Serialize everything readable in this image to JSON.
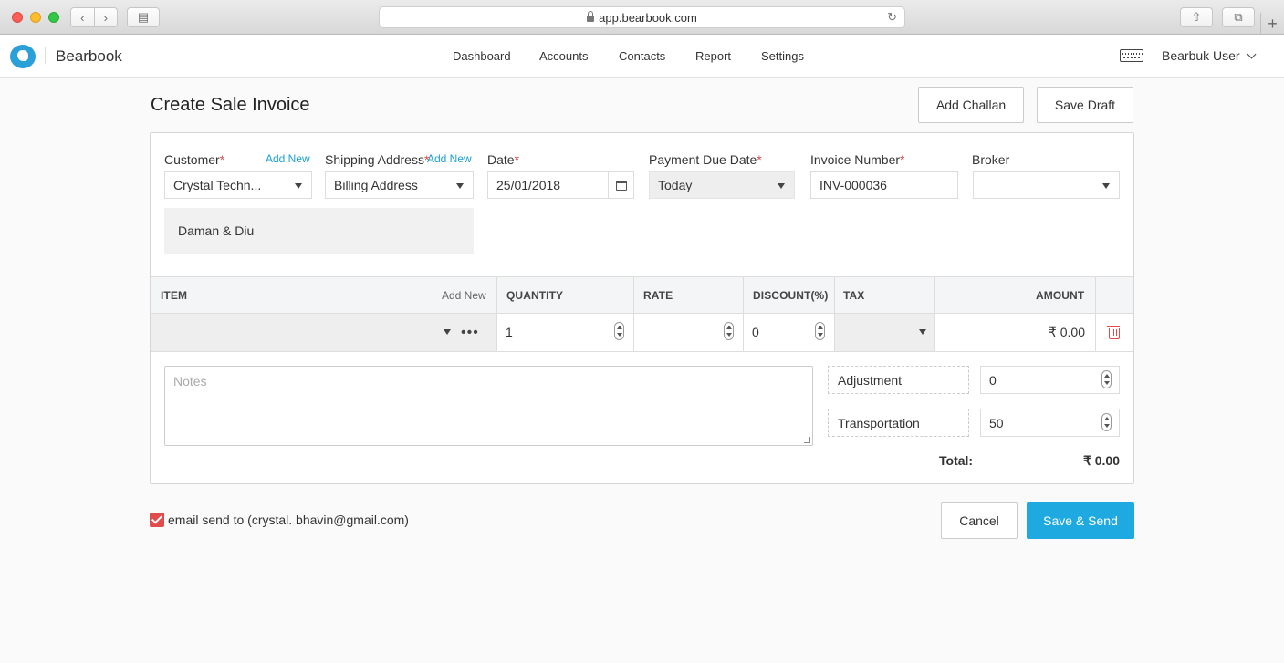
{
  "browser": {
    "url": "app.bearbook.com"
  },
  "app": {
    "brand": "Bearbook",
    "nav": [
      "Dashboard",
      "Accounts",
      "Contacts",
      "Report",
      "Settings"
    ],
    "user": "Bearbuk User"
  },
  "page": {
    "title": "Create Sale Invoice",
    "add_challan": "Add Challan",
    "save_draft": "Save Draft"
  },
  "form": {
    "customer": {
      "label": "Customer",
      "add_new": "Add New",
      "value": "Crystal Techn..."
    },
    "shipping": {
      "label": "Shipping Address",
      "add_new": "Add New",
      "value": "Billing Address"
    },
    "date": {
      "label": "Date",
      "value": "25/01/2018"
    },
    "due_date": {
      "label": "Payment Due Date",
      "value": "Today"
    },
    "invoice_number": {
      "label": "Invoice Number",
      "value": "INV-000036"
    },
    "broker": {
      "label": "Broker",
      "value": ""
    },
    "address": "Daman & Diu",
    "required_mark": "*"
  },
  "items": {
    "headers": {
      "item": "ITEM",
      "add_new": "Add New",
      "quantity": "QUANTITY",
      "rate": "RATE",
      "discount": "DISCOUNT(%)",
      "tax": "TAX",
      "amount": "AMOUNT"
    },
    "rows": [
      {
        "item": "",
        "quantity": "1",
        "rate": "",
        "discount": "0",
        "tax": "",
        "amount": "₹ 0.00"
      }
    ]
  },
  "summary": {
    "notes_placeholder": "Notes",
    "adjustment_label": "Adjustment",
    "adjustment_value": "0",
    "transport_label": "Transportation",
    "transport_value": "50",
    "total_label": "Total:",
    "total_value": "₹ 0.00"
  },
  "footer": {
    "email_checked": true,
    "email_label": "email send to (crystal. bhavin@gmail.com)",
    "cancel": "Cancel",
    "save_send": "Save & Send"
  },
  "colors": {
    "accent": "#1fa9e1",
    "required": "#e04b4b",
    "link": "#1a9fd6"
  }
}
